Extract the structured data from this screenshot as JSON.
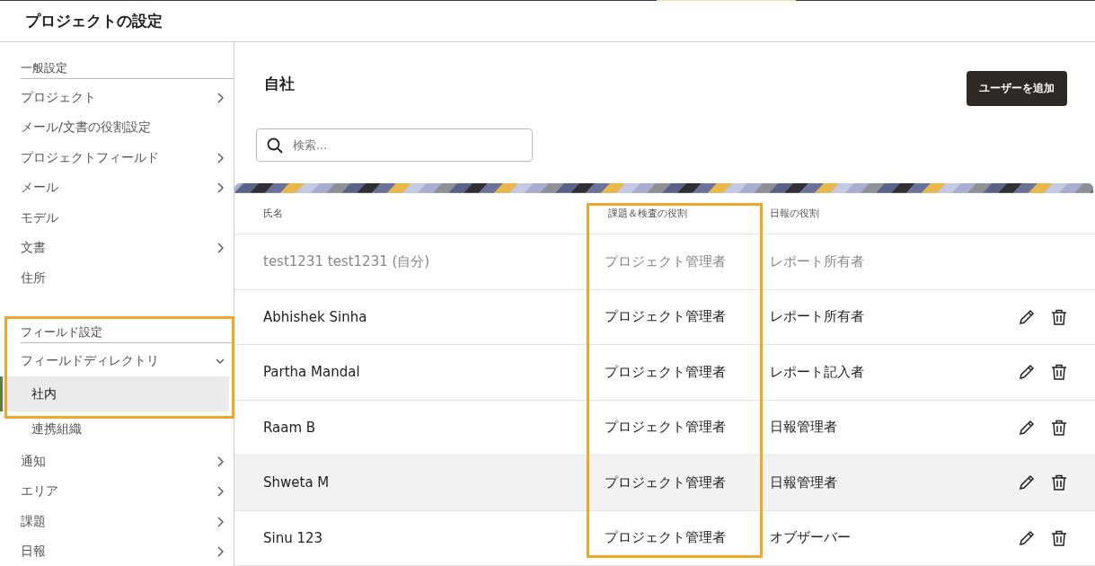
{
  "header": {
    "title": "プロジェクトの設定"
  },
  "sidebar": {
    "sections": [
      {
        "title": "一般設定",
        "items": [
          {
            "label": "プロジェクト",
            "submenu": true
          },
          {
            "label": "メール/文書の役割設定",
            "submenu": false
          },
          {
            "label": "プロジェクトフィールド",
            "submenu": true
          },
          {
            "label": "メール",
            "submenu": true
          },
          {
            "label": "モデル",
            "submenu": false
          },
          {
            "label": "文書",
            "submenu": true
          },
          {
            "label": "住所",
            "submenu": false
          }
        ]
      },
      {
        "title": "フィールド設定",
        "items": [
          {
            "label": "フィールドディレクトリ",
            "expanded": true,
            "children": [
              {
                "label": "社内",
                "selected": true
              },
              {
                "label": "連携組織",
                "selected": false
              }
            ]
          },
          {
            "label": "通知",
            "submenu": true
          },
          {
            "label": "エリア",
            "submenu": true
          },
          {
            "label": "課題",
            "submenu": true
          },
          {
            "label": "日報",
            "submenu": true
          }
        ]
      }
    ]
  },
  "main": {
    "title": "自社",
    "add_button": "ユーザーを追加",
    "search": {
      "placeholder": "検索..."
    },
    "table": {
      "columns": [
        "氏名",
        "課題＆検査の役割",
        "日報の役割"
      ],
      "rows": [
        {
          "cells": [
            "test1231 test1231 (自分)",
            "プロジェクト管理者",
            "レポート所有者"
          ],
          "disabled": true,
          "hovered": false
        },
        {
          "cells": [
            "Abhishek Sinha",
            "プロジェクト管理者",
            "レポート所有者"
          ],
          "disabled": false,
          "hovered": false
        },
        {
          "cells": [
            "Partha Mandal",
            "プロジェクト管理者",
            "レポート記入者"
          ],
          "disabled": false,
          "hovered": false
        },
        {
          "cells": [
            "Raam B",
            "プロジェクト管理者",
            "日報管理者"
          ],
          "disabled": false,
          "hovered": false
        },
        {
          "cells": [
            "Shweta M",
            "プロジェクト管理者",
            "日報管理者"
          ],
          "disabled": false,
          "hovered": true
        },
        {
          "cells": [
            "Sinu 123",
            "プロジェクト管理者",
            "オブザーバー"
          ],
          "disabled": false,
          "hovered": false
        }
      ]
    }
  }
}
